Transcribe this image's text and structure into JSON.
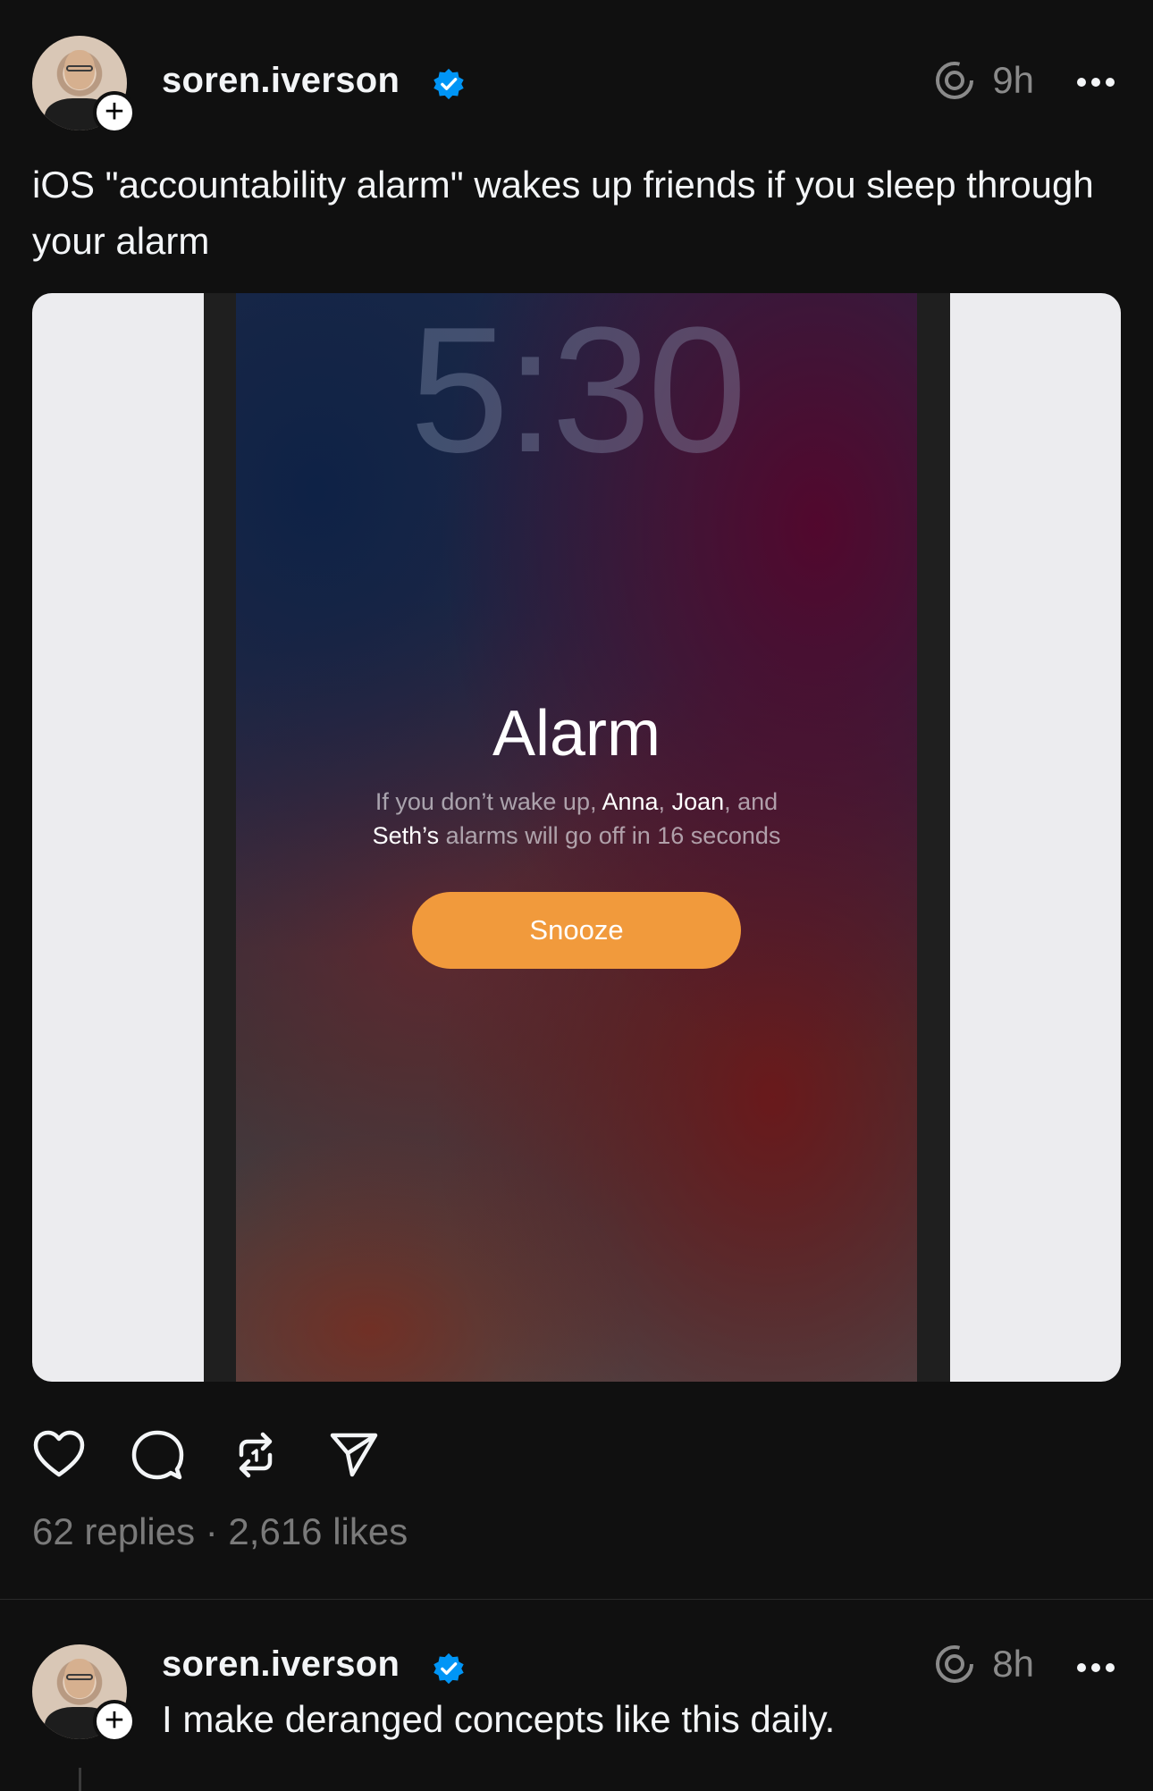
{
  "post": {
    "username": "soren.iverson",
    "time": "9h",
    "text": "iOS \"accountability alarm\" wakes up friends if you sleep through your alarm",
    "media": {
      "lock_time": "5:30",
      "alarm_title": "Alarm",
      "msg_part1": "If you don’t wake up, ",
      "name1": "Anna",
      "msg_sep1": ", ",
      "name2": "Joan",
      "msg_sep2": ", and",
      "name3": "Seth’s",
      "msg_part2": " alarms will go off in 16 seconds",
      "snooze_label": "Snooze",
      "snooze_color": "#f19a3c"
    },
    "stats": "62 replies · 2,616 likes"
  },
  "reply": {
    "username": "soren.iverson",
    "time": "8h",
    "text": "I make deranged concepts like this daily."
  },
  "icons": {
    "verified": "verified-badge-icon",
    "threads": "threads-logo-icon",
    "more": "more-options-icon",
    "like": "heart-icon",
    "comment": "comment-bubble-icon",
    "repost": "repost-icon",
    "share": "share-send-icon",
    "follow": "plus-icon"
  },
  "colors": {
    "background": "#101010",
    "verified": "#0095f6",
    "muted": "#7a7a7a"
  }
}
